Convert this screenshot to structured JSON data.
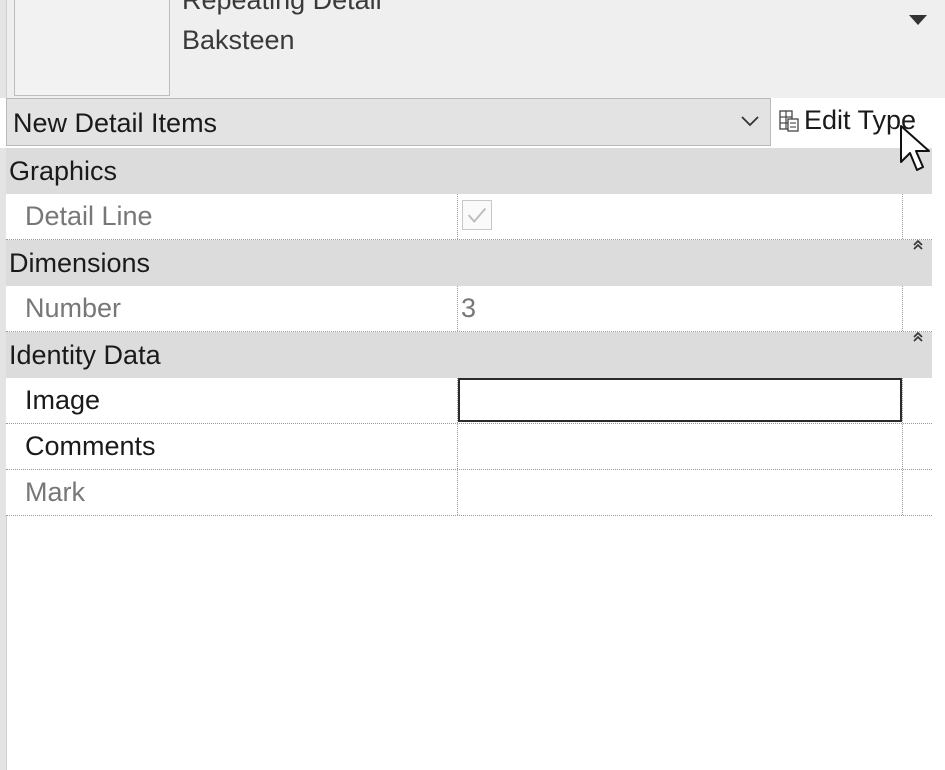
{
  "type_selector": {
    "family": "Repeating Detail",
    "type": "Baksteen",
    "dropdown_icon": "triangle-down-icon"
  },
  "instance_filter": {
    "selected": "New Detail Items",
    "chevron_icon": "chevron-down-icon"
  },
  "edit_type": {
    "label": "Edit Type",
    "icon": "edit-type-icon"
  },
  "sections": [
    {
      "title": "Graphics",
      "rows": [
        {
          "name": "Detail Line",
          "type": "checkbox",
          "checked": true,
          "disabled": true
        }
      ]
    },
    {
      "title": "Dimensions",
      "rows": [
        {
          "name": "Number",
          "value": "3",
          "disabled": true
        }
      ]
    },
    {
      "title": "Identity Data",
      "rows": [
        {
          "name": "Image",
          "value": "",
          "disabled": false,
          "active": true
        },
        {
          "name": "Comments",
          "value": "",
          "disabled": false
        },
        {
          "name": "Mark",
          "value": "",
          "disabled": true
        }
      ]
    }
  ],
  "colors": {
    "section_bg": "#dcdcdc",
    "disabled_text": "#777777",
    "header_bg": "#efefef"
  }
}
